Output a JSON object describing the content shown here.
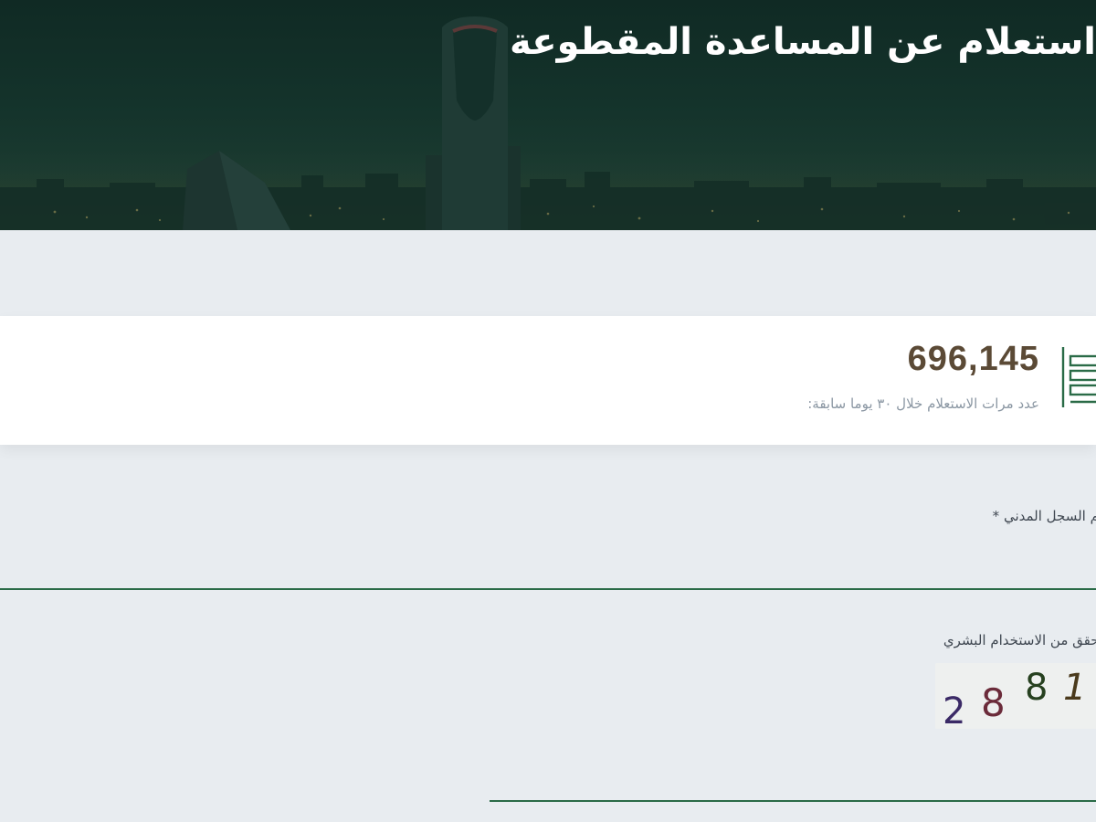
{
  "hero": {
    "title": "استعلام عن المساعدة المقطوعة"
  },
  "stats": {
    "count": "696,145",
    "caption": "عدد مرات الاستعلام خلال ٣٠ يوما سابقة:",
    "icon": "document-list-icon"
  },
  "form": {
    "civil_id_label": "رقم السجل المدني *",
    "civil_id_value": "",
    "captcha_label": "للتحقق من الاستخدام البشري",
    "captcha_digits": [
      "2",
      "8",
      "8",
      "1"
    ],
    "captcha_value": ""
  },
  "colors": {
    "accent_green": "#2a6b47",
    "count_brown": "#5b4a36",
    "caption_gray": "#8b97a3",
    "page_background": "#e8ecf0"
  }
}
